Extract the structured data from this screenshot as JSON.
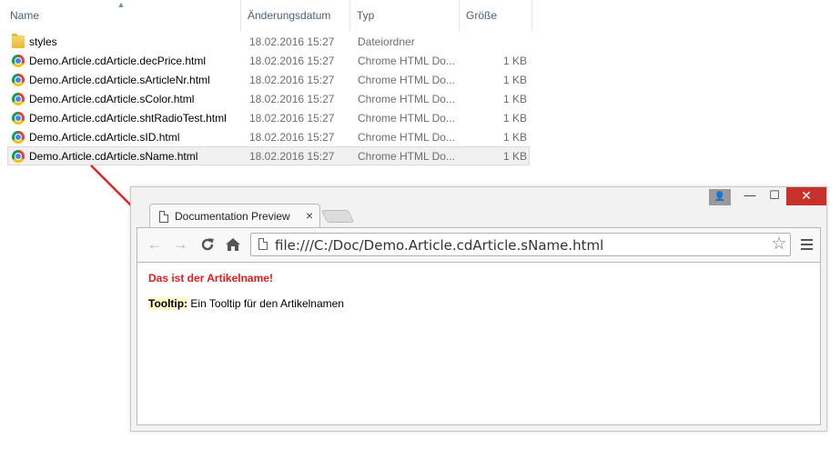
{
  "explorer": {
    "columns": {
      "name": "Name",
      "date": "Änderungsdatum",
      "type": "Typ",
      "size": "Größe"
    },
    "sort_indicator": "▲",
    "files": [
      {
        "icon": "folder-icon",
        "name": "styles",
        "date": "18.02.2016 15:27",
        "type": "Dateiordner",
        "size": ""
      },
      {
        "icon": "chrome-icon",
        "name": "Demo.Article.cdArticle.decPrice.html",
        "date": "18.02.2016 15:27",
        "type": "Chrome HTML Do...",
        "size": "1 KB"
      },
      {
        "icon": "chrome-icon",
        "name": "Demo.Article.cdArticle.sArticleNr.html",
        "date": "18.02.2016 15:27",
        "type": "Chrome HTML Do...",
        "size": "1 KB"
      },
      {
        "icon": "chrome-icon",
        "name": "Demo.Article.cdArticle.sColor.html",
        "date": "18.02.2016 15:27",
        "type": "Chrome HTML Do...",
        "size": "1 KB"
      },
      {
        "icon": "chrome-icon",
        "name": "Demo.Article.cdArticle.shtRadioTest.html",
        "date": "18.02.2016 15:27",
        "type": "Chrome HTML Do...",
        "size": "1 KB"
      },
      {
        "icon": "chrome-icon",
        "name": "Demo.Article.cdArticle.sID.html",
        "date": "18.02.2016 15:27",
        "type": "Chrome HTML Do...",
        "size": "1 KB"
      },
      {
        "icon": "chrome-icon",
        "name": "Demo.Article.cdArticle.sName.html",
        "date": "18.02.2016 15:27",
        "type": "Chrome HTML Do...",
        "size": "1 KB",
        "selected": true
      }
    ]
  },
  "annotation": {
    "arrow_color": "#e8231c"
  },
  "browser": {
    "window_controls": {
      "user": "👤",
      "minimize": "—",
      "maximize": "☐",
      "close": "✕"
    },
    "tab": {
      "title": "Documentation Preview",
      "close": "×"
    },
    "toolbar": {
      "back": "←",
      "forward": "→",
      "reload": "C",
      "home": "⌂",
      "url": "file:///C:/Doc/Demo.Article.cdArticle.sName.html",
      "bookmark": "☆"
    },
    "page": {
      "heading": "Das ist der Artikelname!",
      "heading_color": "#e01b1b",
      "tooltip_label": "Tooltip:",
      "tooltip_text": " Ein Tooltip für den Artikelnamen"
    }
  }
}
